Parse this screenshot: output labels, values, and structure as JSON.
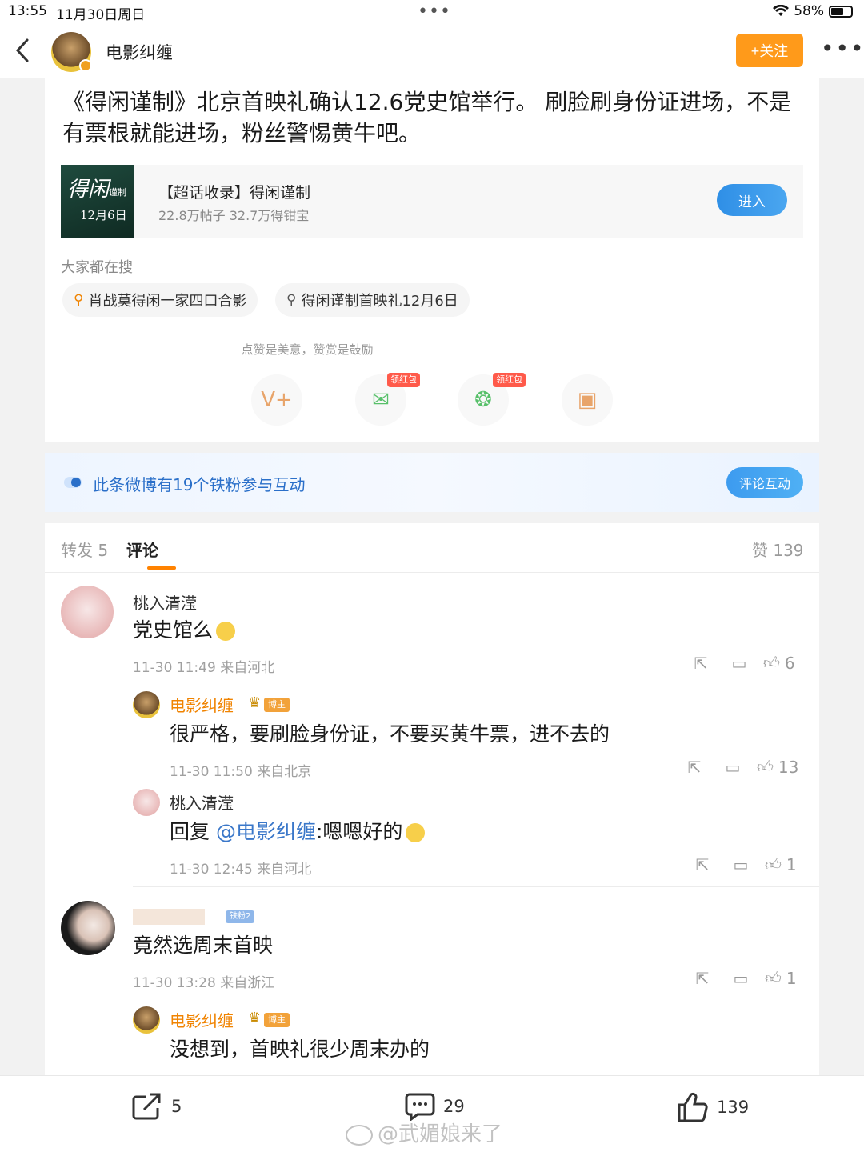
{
  "status_bar": {
    "time": "13:55",
    "date": "11月30日周日",
    "dots": "•••",
    "battery": "58%"
  },
  "nav": {
    "account_name": "电影纠缠",
    "follow_label": "+关注",
    "more_label": "•••"
  },
  "post": {
    "text": "《得闲谨制》北京首映礼确认12.6党史馆举行。 刷脸刷身份证进场，不是有票根就能进场，粉丝警惕黄牛吧。",
    "topic": {
      "cover_title": "得闲",
      "cover_sub": "谨制",
      "cover_date": "12月6日",
      "title": "【超话收录】得闲谨制",
      "stats": "22.8万帖子 32.7万得钳宝",
      "enter_label": "进入"
    },
    "search_label": "大家都在搜",
    "search_chips": [
      {
        "text": "肖战莫得闲一家四口合影"
      },
      {
        "text": "得闲谨制首映礼12月6日"
      }
    ],
    "reward_tip": "点赞是美意，赞赏是鼓励",
    "red_packet_label": "领红包"
  },
  "fans_banner": {
    "text": "此条微博有19个铁粉参与互动",
    "button": "评论互动"
  },
  "tabs": {
    "repost": "转发 5",
    "comments": "评论",
    "likes": "赞 139"
  },
  "comments": [
    {
      "user": "桃入清滢",
      "text": "党史馆么",
      "meta": "11-30 11:49 来自河北",
      "likes": "6",
      "reply": {
        "user": "电影纠缠",
        "badge": "博主",
        "text": "很严格，要刷脸身份证，不要买黄牛票，进不去的",
        "meta": "11-30 11:50 来自北京",
        "likes": "13"
      },
      "reply2": {
        "user": "桃入清滢",
        "prefix": "回复 ",
        "mention": "@电影纠缠",
        "text": ":嗯嗯好的",
        "meta": "11-30 12:45 来自河北",
        "likes": "1"
      }
    },
    {
      "fan_badge": "铁粉2",
      "text": "竟然选周末首映",
      "meta": "11-30 13:28 来自浙江",
      "likes": "1",
      "reply": {
        "user": "电影纠缠",
        "badge": "博主",
        "text": "没想到，首映礼很少周末办的"
      }
    }
  ],
  "bottom_bar": {
    "repost_count": "5",
    "comment_count": "29",
    "like_count": "139"
  },
  "watermark": "@武媚娘来了",
  "colors": {
    "accent_orange": "#ff9a1a",
    "link_blue": "#3a77c9",
    "owner_orange": "#f08300"
  }
}
